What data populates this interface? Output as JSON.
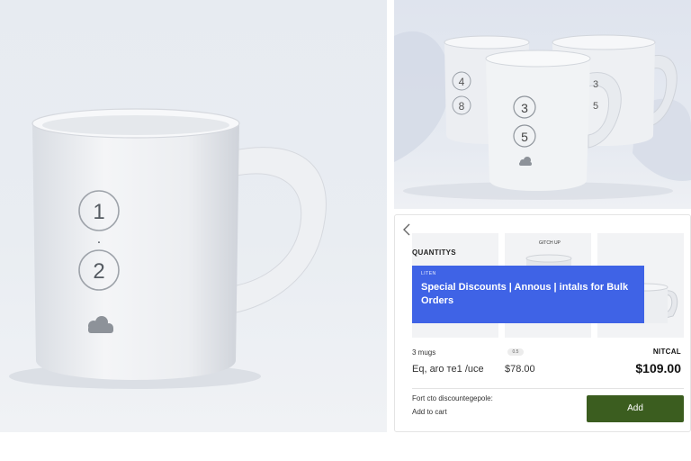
{
  "hero": {
    "mug_numbers": [
      "1",
      "2"
    ],
    "separator": ".",
    "colors": {
      "background": "#e8ecf1",
      "mug": "#f5f6f8"
    }
  },
  "scene": {
    "mug_numbers": [
      "4",
      "8",
      "3",
      "5",
      "3",
      "5"
    ]
  },
  "card": {
    "back_icon": "chevron-left-icon",
    "section_title": "QUANTITYS",
    "thumb_caption": "GITCH UP",
    "banner": {
      "tag": "LITEN",
      "text": "Special Discounts | Annous | intalıs for Bulk Orders",
      "color": "#3f63e6"
    },
    "qty_label": "3 mugs",
    "qty_badge": "0.5",
    "unit_label": "Eq, aro тe1 /uce",
    "unit_price": "$78.00",
    "total_label": "NITCAL",
    "total_price": "$109.00",
    "footer_note": "Fort cto discountegepole:",
    "add_to_cart_label": "Add to cart",
    "add_button_label": "Add",
    "add_button_color": "#3b5d1f"
  }
}
